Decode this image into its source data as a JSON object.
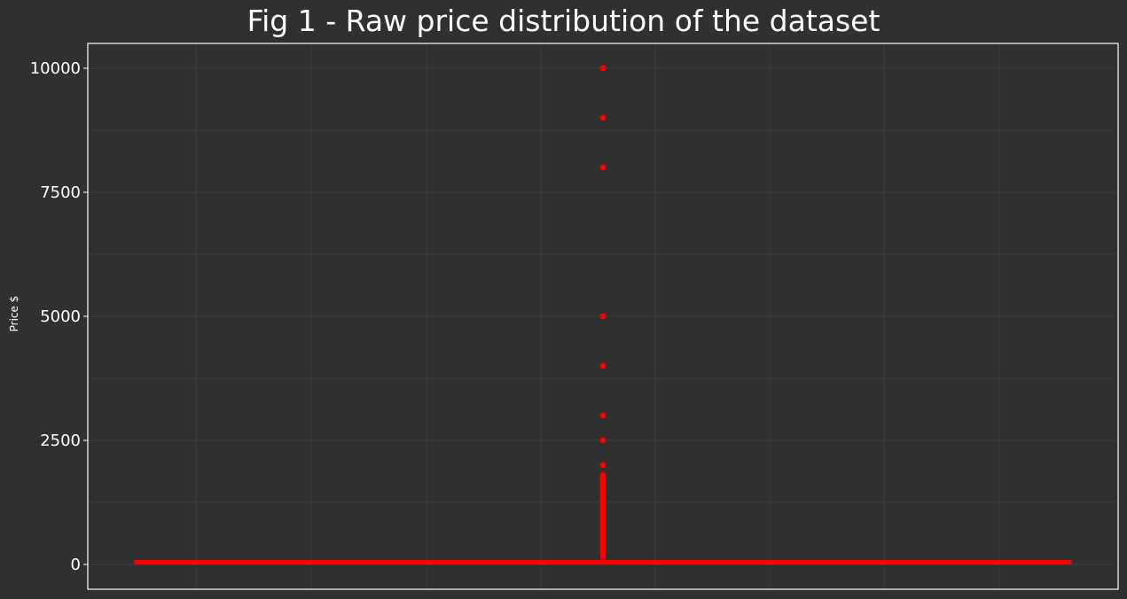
{
  "chart_data": {
    "type": "box",
    "title": "Fig 1 - Raw price distribution of the dataset",
    "xlabel": "",
    "ylabel": "Price $",
    "ylim": [
      -500,
      10500
    ],
    "yticks": [
      0,
      2500,
      5000,
      7500,
      10000
    ],
    "grid": true,
    "box": {
      "q1": 30,
      "median": 40,
      "q3": 55,
      "whisker_low": 0,
      "whisker_high": 100,
      "outliers": [
        10000,
        9000,
        8000,
        5000,
        4000,
        3000,
        2500,
        2000,
        1800,
        1750,
        1700,
        1650,
        1600,
        1550,
        1500,
        1450,
        1400,
        1350,
        1300,
        1250,
        1200,
        1150,
        1100,
        1050,
        1000,
        950,
        900,
        850,
        800,
        750,
        700,
        650,
        600,
        550,
        500,
        450,
        400,
        350,
        300,
        250,
        200,
        150
      ]
    },
    "colors": {
      "background": "#303030",
      "box": "#ff0000",
      "text": "#ffffff",
      "frame": "#ffffff",
      "grid": "#3c3c3c"
    }
  }
}
